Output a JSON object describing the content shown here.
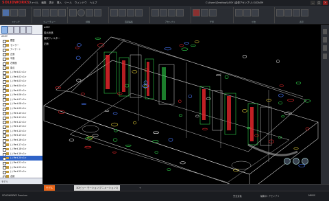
{
  "app": {
    "logo_main": "SOLIDWORKS",
    "menus": [
      "ファイル",
      "編集",
      "表示",
      "挿入",
      "ツール",
      "ウィンドウ",
      "ヘルプ"
    ],
    "file_path": "C:\\Users\\Desktop\\ASSY (金型アセンブリ).SLDASM"
  },
  "ribbon": {
    "groups": [
      "スケッチ",
      "フィーチャー",
      "評価",
      "直接編集",
      "アセンブリ",
      "干渉",
      "寸法",
      "表示"
    ]
  },
  "tree": {
    "header": "ASSY",
    "items": [
      {
        "label": "履歴"
      },
      {
        "label": "センサー"
      },
      {
        "label": "アノテート"
      },
      {
        "label": "正面"
      },
      {
        "label": "平面"
      },
      {
        "label": "右側面"
      },
      {
        "label": "原点"
      },
      {
        "label": "(-) Part-01<1>"
      },
      {
        "label": "(-) Part-02<1>"
      },
      {
        "label": "(-) Part-03<1>"
      },
      {
        "label": "(-) Part-04<1>"
      },
      {
        "label": "(-) Part-05<1>"
      },
      {
        "label": "(-) Part-06<1>"
      },
      {
        "label": "(-) Part-07<1>"
      },
      {
        "label": "(-) Part-08<1>"
      },
      {
        "label": "(-) Part-09<1>"
      },
      {
        "label": "(-) Part-10<1>"
      },
      {
        "label": "(-) Part-11<1>"
      },
      {
        "label": "(-) Part-12<1>"
      },
      {
        "label": "(-) Part-13<1>"
      },
      {
        "label": "(-) Part-14<1>"
      },
      {
        "label": "(-) Part-15<1>"
      },
      {
        "label": "(-) Part-16<1>"
      },
      {
        "label": "(-) Part-17<1>"
      },
      {
        "label": "(-) Part-18<1>"
      },
      {
        "label": "(-) Part-19<1>"
      },
      {
        "label": "(-) Part-20<1>",
        "selected": true
      },
      {
        "label": "(-) Part-21<1>"
      },
      {
        "label": "(-) Part-22<1>"
      },
      {
        "label": "(-) Part-23<1>"
      },
      {
        "label": "合致"
      }
    ],
    "bottom_label": "モデル"
  },
  "viewport": {
    "overlay_menu": [
      "ASSY",
      "表示状態",
      "選択フィルター",
      "正面"
    ]
  },
  "tabs": {
    "items": [
      "モデル",
      "3Dビュー モーション(アニメーション1)"
    ],
    "add": "+"
  },
  "status": {
    "left": "SOLIDWORKS Premium",
    "mid": "完全定義",
    "right": "編集中: アセンブリ",
    "units": "MMGS"
  },
  "colors": {
    "viewport_bg": "#000000",
    "wire_white": "#d8d8d8",
    "wire_green": "#2fd14a",
    "wire_red": "#e3262a",
    "wire_yellow": "#e6d13a",
    "wire_blue": "#4a7bff",
    "tab_active": "#e9661a"
  },
  "icons": [
    "search-icon",
    "gear-icon",
    "rotate-view-icon",
    "zoom-icon"
  ]
}
